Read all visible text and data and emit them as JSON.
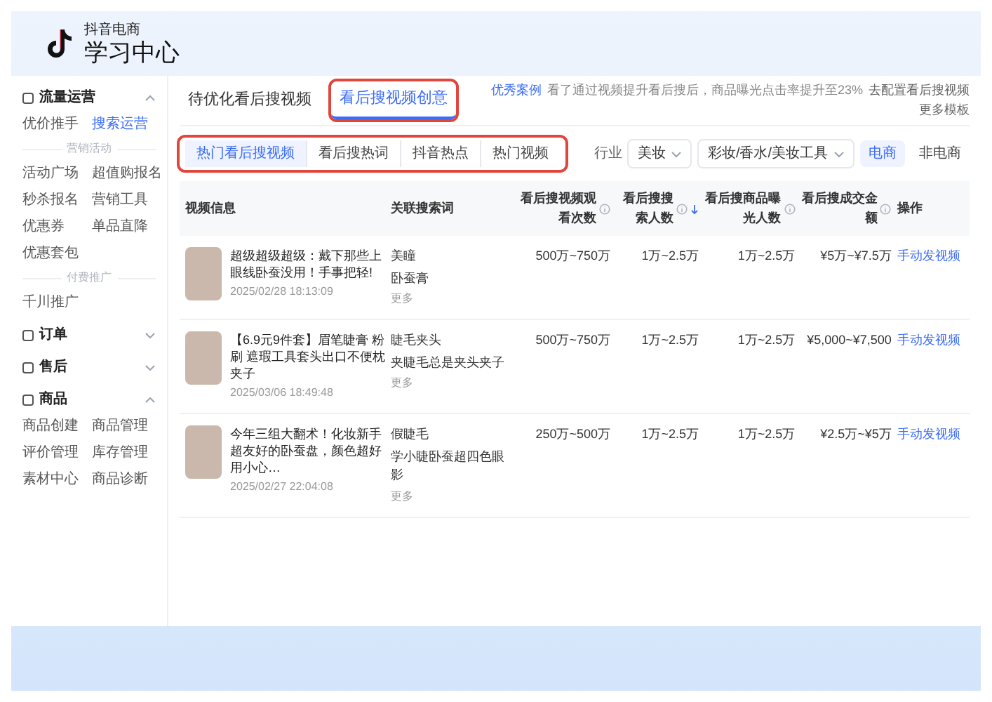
{
  "brand": {
    "subtitle": "抖音电商",
    "title": "学习中心"
  },
  "sidebar": {
    "sections": [
      {
        "label": "流量运营",
        "expanded": true,
        "blocks": [
          {
            "kind": "grid",
            "items": [
              {
                "label": "优价推手",
                "selected": false
              },
              {
                "label": "搜索运营",
                "selected": true
              }
            ]
          },
          {
            "kind": "heading",
            "label": "营销活动"
          },
          {
            "kind": "grid",
            "items": [
              {
                "label": "活动广场",
                "selected": false
              },
              {
                "label": "超值购报名",
                "selected": false
              },
              {
                "label": "秒杀报名",
                "selected": false
              },
              {
                "label": "营销工具",
                "selected": false
              },
              {
                "label": "优惠券",
                "selected": false
              },
              {
                "label": "单品直降",
                "selected": false
              },
              {
                "label": "优惠套包",
                "selected": false
              }
            ]
          },
          {
            "kind": "heading",
            "label": "付费推广"
          },
          {
            "kind": "grid",
            "items": [
              {
                "label": "千川推广",
                "selected": false
              }
            ]
          }
        ]
      },
      {
        "label": "订单",
        "expanded": false
      },
      {
        "label": "售后",
        "expanded": false
      },
      {
        "label": "商品",
        "expanded": true,
        "blocks": [
          {
            "kind": "grid",
            "items": [
              {
                "label": "商品创建",
                "selected": false
              },
              {
                "label": "商品管理",
                "selected": false
              },
              {
                "label": "评价管理",
                "selected": false
              },
              {
                "label": "库存管理",
                "selected": false
              },
              {
                "label": "素材中心",
                "selected": false
              },
              {
                "label": "商品诊断",
                "selected": false
              }
            ]
          }
        ]
      }
    ]
  },
  "tabs": [
    {
      "label": "待优化看后搜视频",
      "selected": false,
      "highlighted": false
    },
    {
      "label": "看后搜视频创意",
      "selected": true,
      "highlighted": true
    }
  ],
  "notice": {
    "tag": "优秀案例",
    "text": "看了通过视频提升看后搜后，商品曝光点击率提升至23%",
    "links": [
      "去配置看后搜视频",
      "更多模板"
    ]
  },
  "subtabs": {
    "highlighted": true,
    "items": [
      {
        "label": "热门看后搜视频",
        "selected": true
      },
      {
        "label": "看后搜热词",
        "selected": false
      },
      {
        "label": "抖音热点",
        "selected": false
      },
      {
        "label": "热门视频",
        "selected": false
      }
    ]
  },
  "filters": {
    "label": "行业",
    "selects": [
      "美妆",
      "彩妆/香水/美妆工具"
    ],
    "options": [
      {
        "label": "电商",
        "selected": true
      },
      {
        "label": "非电商",
        "selected": false
      }
    ]
  },
  "table": {
    "columns": [
      {
        "label": "视频信息"
      },
      {
        "label": "关联搜索词"
      },
      {
        "label": "看后搜视频观看次数",
        "info": true
      },
      {
        "label": "看后搜搜索人数",
        "info": true,
        "sorted": true
      },
      {
        "label": "看后搜商品曝光人数",
        "info": true
      },
      {
        "label": "看后搜成交金额",
        "info": true
      },
      {
        "label": "操作"
      }
    ],
    "rows": [
      {
        "title": "超级超级超级：戴下那些上眼线卧蚕没用！手事把轻!",
        "date": "2025/02/28 18:13:09",
        "terms": [
          "美瞳",
          "卧蚕膏",
          "更多"
        ],
        "views": "500万~750万",
        "searchers": "1万~2.5万",
        "exposure": "1万~2.5万",
        "gmv": "¥5万~¥7.5万",
        "action": "手动发视频"
      },
      {
        "title": "【6.9元9件套】眉笔睫膏 粉刷 遮瑕工具套头出口不便枕夹子",
        "date": "2025/03/06 18:49:48",
        "terms": [
          "睫毛夹头",
          "夹睫毛总是夹头夹子",
          "更多"
        ],
        "views": "500万~750万",
        "searchers": "1万~2.5万",
        "exposure": "1万~2.5万",
        "gmv": "¥5,000~¥7,500",
        "action": "手动发视频"
      },
      {
        "title": "今年三组大翻术！化妆新手超友好的卧蚕盘，颜色超好用小心…",
        "date": "2025/02/27 22:04:08",
        "terms": [
          "假睫毛",
          "学小睫卧蚕超四色眼影",
          "更多"
        ],
        "views": "250万~500万",
        "searchers": "1万~2.5万",
        "exposure": "1万~2.5万",
        "gmv": "¥2.5万~¥5万",
        "action": "手动发视频"
      }
    ]
  }
}
